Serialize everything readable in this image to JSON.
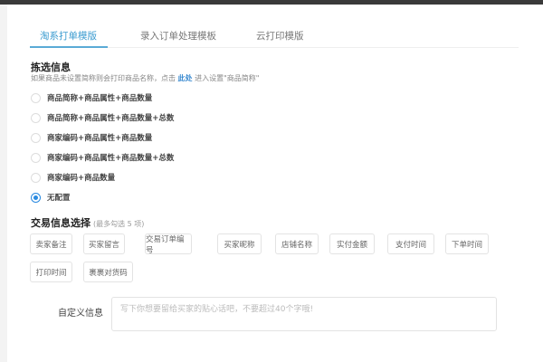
{
  "tabs": [
    {
      "label": "淘系打单模版",
      "active": true
    },
    {
      "label": "录入订单处理模板"
    },
    {
      "label": "云打印模版"
    }
  ],
  "pick": {
    "title": "拣选信息",
    "hint_before": "如果商品未设置简称则会打印商品名称，点击 ",
    "hint_link": "此处",
    "hint_after": " 进入设置\"商品简称\"",
    "options": [
      {
        "label": "商品简称+商品属性+商品数量"
      },
      {
        "label": "商品简称+商品属性+商品数量+总数"
      },
      {
        "label": "商家编码+商品属性+商品数量"
      },
      {
        "label": "商家编码+商品属性+商品数量+总数"
      },
      {
        "label": "商家编码+商品数量"
      },
      {
        "label": "无配置",
        "selected": true
      }
    ]
  },
  "trade": {
    "title": "交易信息选择",
    "note": "(最多勾选 5 项)",
    "tags": [
      "卖家备注",
      "买家留言",
      "交易订单编号",
      "买家昵称",
      "店铺名称",
      "实付金额",
      "支付时间",
      "下单时间",
      "打印时间",
      "裹裹对货码"
    ]
  },
  "custom": {
    "label": "自定义信息",
    "placeholder": "写下你想要留给买家的贴心话吧，不要超过40个字哦!",
    "value": ""
  },
  "colors": {
    "accent": "#3a9bd0",
    "radio": "#2a8ae0"
  }
}
